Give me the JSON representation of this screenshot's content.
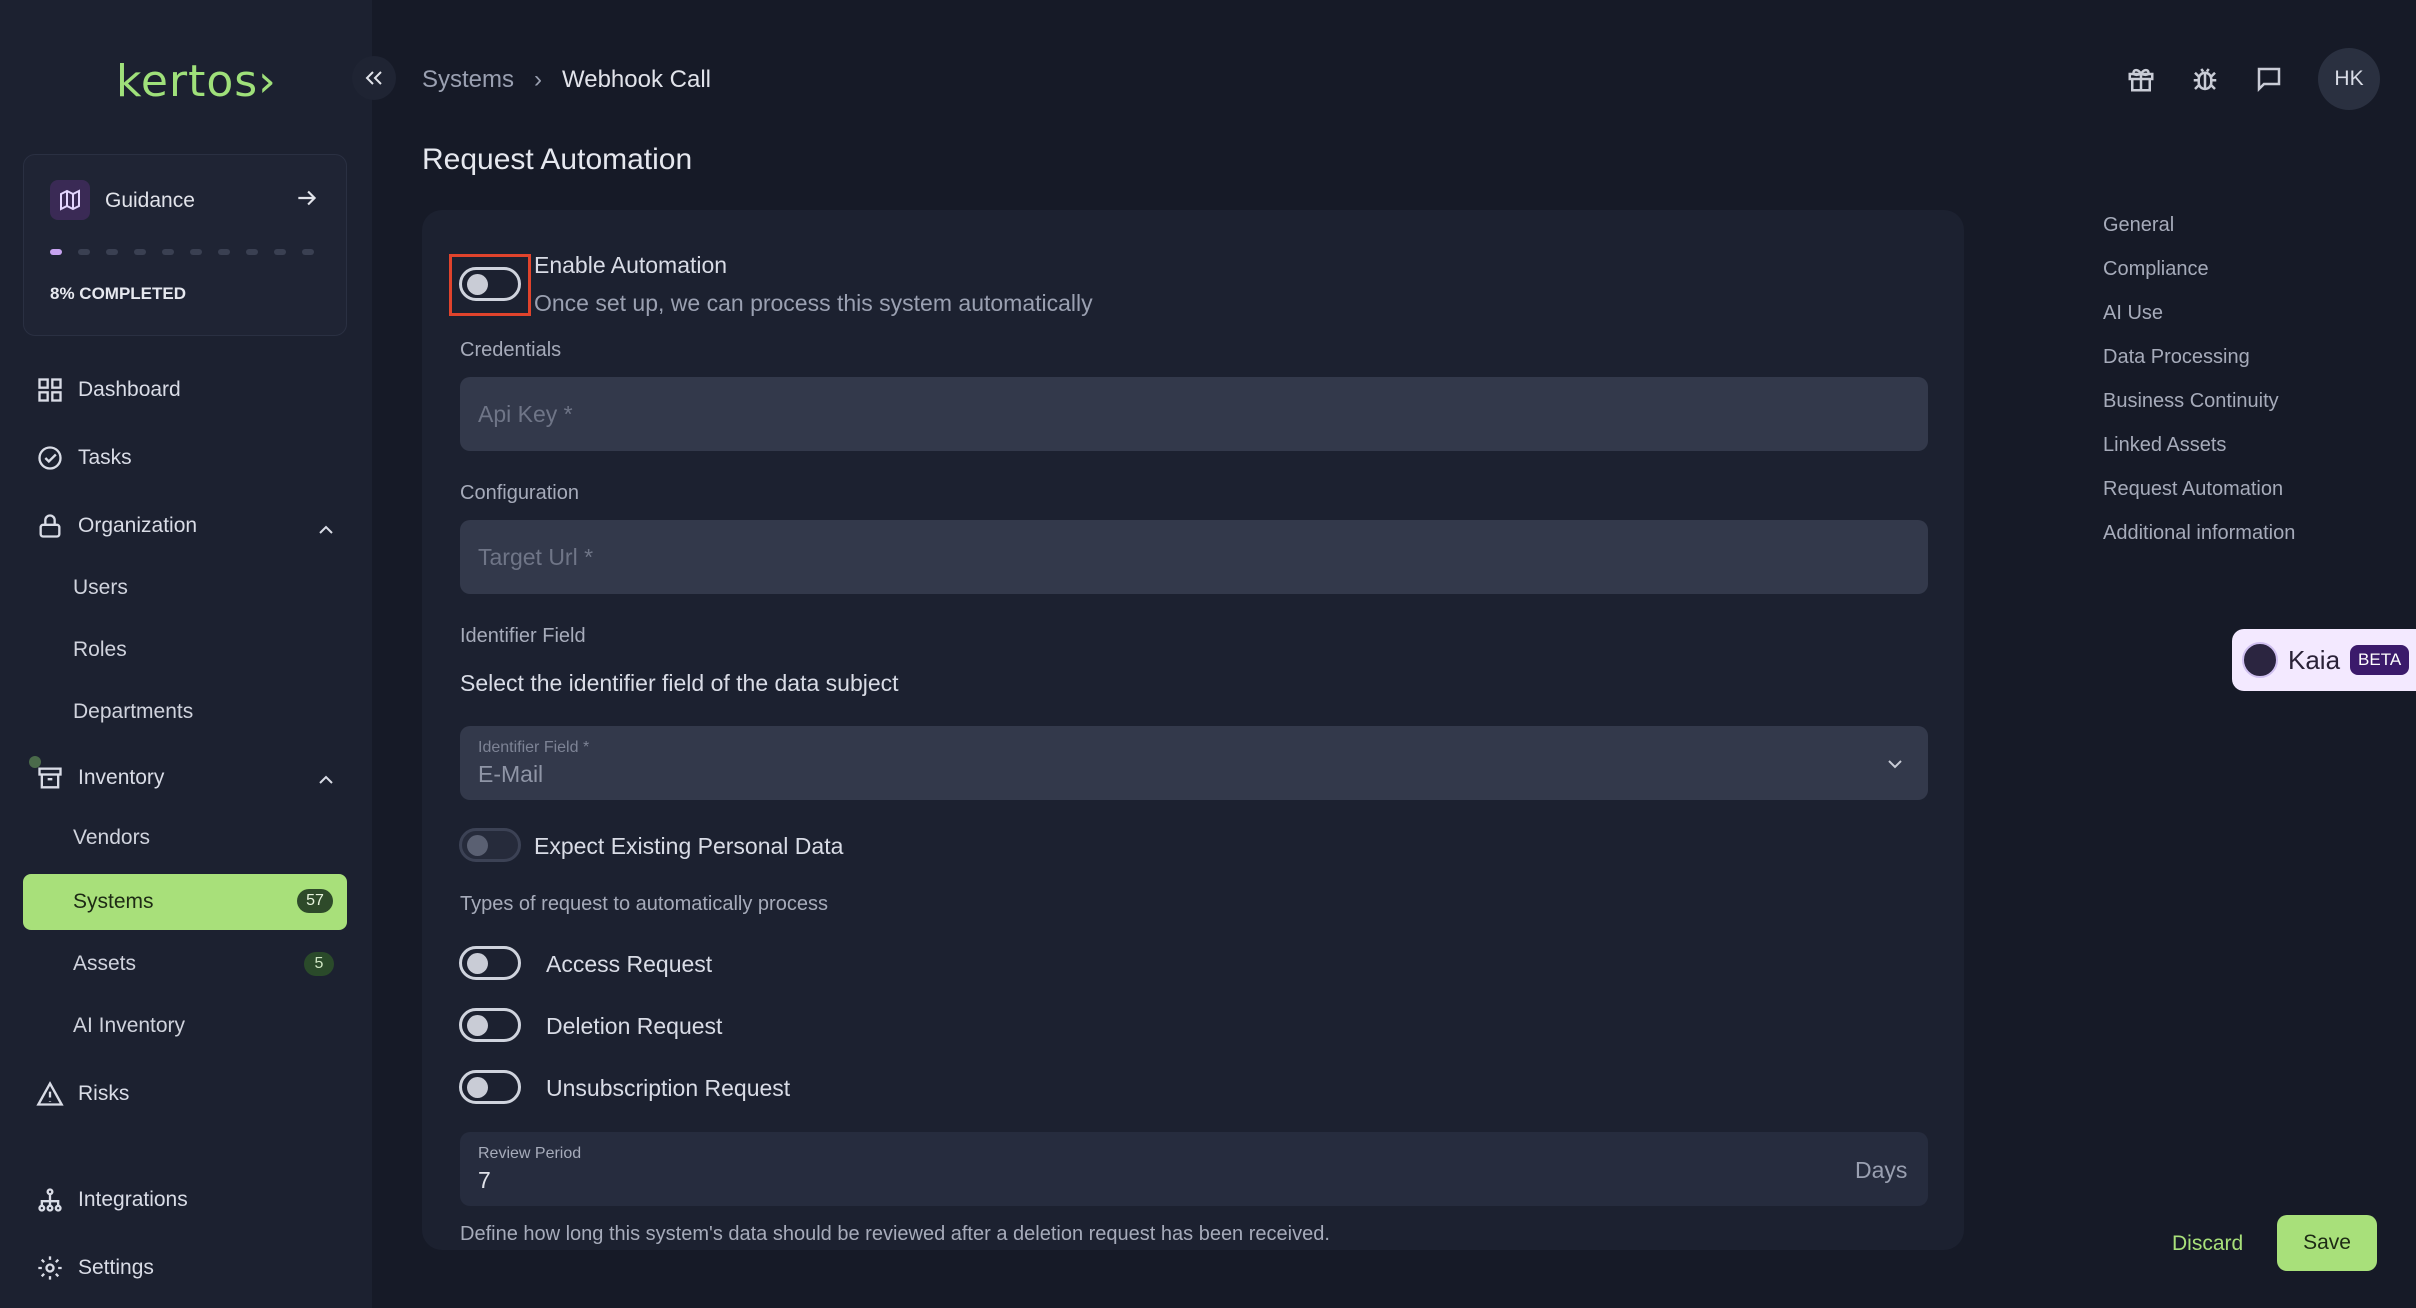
{
  "brand": {
    "logo": "kertos›"
  },
  "guidance": {
    "label": "Guidance",
    "progress_percent": 8,
    "completed_text": "8% COMPLETED",
    "total_steps": 10,
    "done_steps": 1
  },
  "sidebar": {
    "dashboard": "Dashboard",
    "tasks": "Tasks",
    "organization": "Organization",
    "users": "Users",
    "roles": "Roles",
    "departments": "Departments",
    "inventory": "Inventory",
    "vendors": "Vendors",
    "systems": "Systems",
    "systems_count": "57",
    "assets": "Assets",
    "assets_count": "5",
    "ai_inventory": "AI Inventory",
    "risks": "Risks",
    "integrations": "Integrations",
    "settings": "Settings"
  },
  "breadcrumb": {
    "parent": "Systems",
    "separator": "›",
    "current": "Webhook Call"
  },
  "user": {
    "initials": "HK"
  },
  "page": {
    "title": "Request Automation"
  },
  "form": {
    "enable_title": "Enable Automation",
    "enable_desc": "Once set up, we can process this system automatically",
    "credentials_label": "Credentials",
    "api_key_placeholder": "Api Key *",
    "configuration_label": "Configuration",
    "target_url_placeholder": "Target Url *",
    "identifier_section": "Identifier Field",
    "identifier_desc": "Select the identifier field of the data subject",
    "identifier_field_label": "Identifier Field *",
    "identifier_value": "E-Mail",
    "expect_existing": "Expect Existing Personal Data",
    "types_label": "Types of request to automatically process",
    "access_request": "Access Request",
    "deletion_request": "Deletion Request",
    "unsubscription_request": "Unsubscription Request",
    "review_period_label": "Review Period",
    "review_period_value": "7",
    "review_period_unit": "Days",
    "review_period_help": "Define how long this system's data should be reviewed after a deletion request has been received."
  },
  "right_nav": [
    "General",
    "Compliance",
    "AI Use",
    "Data Processing",
    "Business Continuity",
    "Linked Assets",
    "Request Automation",
    "Additional information"
  ],
  "kaia": {
    "name": "Kaia",
    "tag": "BETA"
  },
  "actions": {
    "discard": "Discard",
    "save": "Save"
  }
}
